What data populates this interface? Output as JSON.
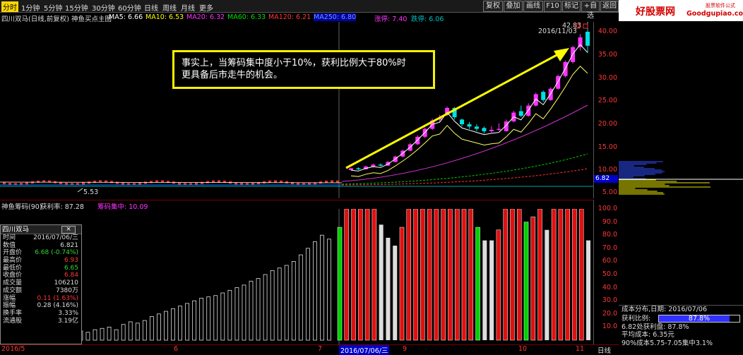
{
  "toolbar": {
    "timeframes": [
      "分时",
      "1分钟",
      "5分钟",
      "15分钟",
      "30分钟",
      "60分钟",
      "日线",
      "周线",
      "月线",
      "更多"
    ],
    "active": "分时",
    "right_buttons": [
      "复权",
      "叠加",
      "画线",
      "F10",
      "标记",
      "+自选",
      "返回"
    ]
  },
  "brand": {
    "logo": "好股票网",
    "small": "股票软件公式",
    "url": "Goodgupiao.com"
  },
  "infobar": {
    "title": "四川双马(日线,前复权) 神鱼买点主图",
    "ma5": "MA5: 6.66",
    "ma10": "MA10: 6.53",
    "ma20": "MA20: 6.32",
    "ma60": "MA60: 6.33",
    "ma120": "MA120: 6.21",
    "ma250": "MA250: 6.80",
    "zt": "涨停: 7.40",
    "dt": "跌停: 6.06"
  },
  "main_chart": {
    "high_label": "2016/11/03",
    "high_value": "42.83",
    "low_value": "5.53",
    "current_price": "6.82",
    "y_ticks": [
      "40.00",
      "35.00",
      "30.00",
      "25.00",
      "20.00",
      "15.00",
      "10.00",
      "5.00"
    ],
    "y_values": [
      40,
      35,
      30,
      25,
      20,
      15,
      10,
      5
    ],
    "candles": [
      {
        "o": 10.0,
        "c": 10.4,
        "h": 10.5,
        "l": 9.9
      },
      {
        "o": 10.4,
        "c": 10.2,
        "h": 10.6,
        "l": 10.0
      },
      {
        "o": 10.2,
        "c": 10.8,
        "h": 11.0,
        "l": 10.1
      },
      {
        "o": 10.8,
        "c": 11.2,
        "h": 11.4,
        "l": 10.6
      },
      {
        "o": 11.2,
        "c": 11.0,
        "h": 11.5,
        "l": 10.8
      },
      {
        "o": 11.0,
        "c": 11.8,
        "h": 12.0,
        "l": 10.9
      },
      {
        "o": 11.8,
        "c": 13.0,
        "h": 13.2,
        "l": 11.7
      },
      {
        "o": 13.0,
        "c": 14.3,
        "h": 14.5,
        "l": 12.8
      },
      {
        "o": 14.3,
        "c": 15.7,
        "h": 16.0,
        "l": 14.2
      },
      {
        "o": 15.7,
        "c": 17.3,
        "h": 17.6,
        "l": 15.5
      },
      {
        "o": 17.3,
        "c": 19.0,
        "h": 19.3,
        "l": 17.0
      },
      {
        "o": 19.0,
        "c": 20.8,
        "h": 21.2,
        "l": 18.8
      },
      {
        "o": 21.0,
        "c": 21.3,
        "h": 22.0,
        "l": 20.5
      },
      {
        "o": 22.0,
        "c": 23.5,
        "h": 23.8,
        "l": 21.8
      },
      {
        "o": 23.5,
        "c": 21.5,
        "h": 23.7,
        "l": 21.0
      },
      {
        "o": 21.0,
        "c": 20.0,
        "h": 21.2,
        "l": 19.5
      },
      {
        "o": 20.0,
        "c": 19.5,
        "h": 20.5,
        "l": 19.0
      },
      {
        "o": 19.5,
        "c": 19.0,
        "h": 20.0,
        "l": 18.5
      },
      {
        "o": 19.2,
        "c": 18.5,
        "h": 19.5,
        "l": 18.0
      },
      {
        "o": 18.5,
        "c": 18.8,
        "h": 19.6,
        "l": 18.2
      },
      {
        "o": 18.8,
        "c": 19.0,
        "h": 20.2,
        "l": 18.6
      },
      {
        "o": 18.5,
        "c": 20.6,
        "h": 21.0,
        "l": 18.4
      },
      {
        "o": 20.6,
        "c": 22.5,
        "h": 22.9,
        "l": 20.4
      },
      {
        "o": 22.8,
        "c": 21.8,
        "h": 24.0,
        "l": 21.5
      },
      {
        "o": 21.8,
        "c": 24.0,
        "h": 24.5,
        "l": 21.6
      },
      {
        "o": 24.0,
        "c": 26.5,
        "h": 26.8,
        "l": 23.8
      },
      {
        "o": 27.0,
        "c": 25.2,
        "h": 27.3,
        "l": 24.8
      },
      {
        "o": 25.2,
        "c": 27.7,
        "h": 28.0,
        "l": 25.0
      },
      {
        "o": 27.7,
        "c": 30.5,
        "h": 30.8,
        "l": 27.5
      },
      {
        "o": 30.5,
        "c": 33.5,
        "h": 33.8,
        "l": 30.2
      },
      {
        "o": 33.5,
        "c": 36.7,
        "h": 37.0,
        "l": 33.2
      },
      {
        "o": 36.7,
        "c": 38.8,
        "h": 39.5,
        "l": 36.0
      },
      {
        "o": 40.0,
        "c": 37.0,
        "h": 42.8,
        "l": 35.5
      }
    ]
  },
  "callout": {
    "line1": "事实上，当筹码集中度小于10%，获利比例大于80%时",
    "line2": "更具备后市走牛的机会。"
  },
  "indicator": {
    "title": "神鱼筹码(90)",
    "profit_label": "获利率: 87.28",
    "conc_label": "筹码集中: 10.09",
    "y_ticks": [
      "100.0",
      "90.0",
      "80.0",
      "70.0",
      "60.0",
      "50.0",
      "40.0",
      "30.0",
      "20.0",
      "10.0"
    ],
    "y_values": [
      100,
      90,
      80,
      70,
      60,
      50,
      40,
      30,
      20,
      10
    ],
    "pre_bars": [
      3,
      2,
      4,
      3,
      5,
      3,
      4,
      6,
      5,
      7,
      6,
      8,
      9,
      10,
      8,
      12,
      14,
      13,
      15,
      18,
      20,
      22,
      24,
      26,
      28,
      30,
      32,
      33,
      34,
      36,
      38,
      40,
      42,
      45,
      47,
      50,
      53,
      55,
      57,
      60,
      65,
      70,
      75,
      80,
      77
    ],
    "post_bars": [
      {
        "v": 86,
        "c": "g"
      },
      {
        "v": 100,
        "c": "r"
      },
      {
        "v": 100,
        "c": "r"
      },
      {
        "v": 100,
        "c": "r"
      },
      {
        "v": 100,
        "c": "r"
      },
      {
        "v": 100,
        "c": "r"
      },
      {
        "v": 88,
        "c": "w"
      },
      {
        "v": 78,
        "c": "w"
      },
      {
        "v": 72,
        "c": "w"
      },
      {
        "v": 86,
        "c": "r"
      },
      {
        "v": 100,
        "c": "r"
      },
      {
        "v": 100,
        "c": "r"
      },
      {
        "v": 100,
        "c": "r"
      },
      {
        "v": 100,
        "c": "r"
      },
      {
        "v": 100,
        "c": "r"
      },
      {
        "v": 100,
        "c": "r"
      },
      {
        "v": 100,
        "c": "r"
      },
      {
        "v": 100,
        "c": "r"
      },
      {
        "v": 100,
        "c": "r"
      },
      {
        "v": 100,
        "c": "r"
      },
      {
        "v": 86,
        "c": "g"
      },
      {
        "v": 76,
        "c": "w"
      },
      {
        "v": 76,
        "c": "w"
      },
      {
        "v": 84,
        "c": "r"
      },
      {
        "v": 100,
        "c": "r"
      },
      {
        "v": 100,
        "c": "r"
      },
      {
        "v": 100,
        "c": "r"
      },
      {
        "v": 90,
        "c": "g"
      },
      {
        "v": 94,
        "c": "r"
      },
      {
        "v": 100,
        "c": "r"
      },
      {
        "v": 84,
        "c": "w"
      },
      {
        "v": 100,
        "c": "r"
      },
      {
        "v": 100,
        "c": "r"
      },
      {
        "v": 100,
        "c": "r"
      },
      {
        "v": 100,
        "c": "r"
      },
      {
        "v": 100,
        "c": "r"
      },
      {
        "v": 76,
        "c": "w"
      }
    ]
  },
  "dates": {
    "d0": "2016/5",
    "d1": "6",
    "d2": "7",
    "cursor": "2016/07/06/三",
    "d3": "9",
    "d4": "10",
    "d5": "11",
    "weekly": "日线"
  },
  "quote": {
    "title": "四川双马",
    "close": "×",
    "rows": [
      {
        "label": "时间",
        "value": "2016/07/06/三",
        "color": "#ddd"
      },
      {
        "label": "数值",
        "value": "6.821",
        "color": "#ddd"
      },
      {
        "label": "开盘价",
        "value": "6.68 (-0.74%)",
        "color": "#34d834"
      },
      {
        "label": "最高价",
        "value": "6.93",
        "color": "#ff3838"
      },
      {
        "label": "最低价",
        "value": "6.65",
        "color": "#34d834"
      },
      {
        "label": "收盘价",
        "value": "6.84",
        "color": "#ff3838"
      },
      {
        "label": "成交量",
        "value": "106210",
        "color": "#ddd"
      },
      {
        "label": "成交额",
        "value": "7380万",
        "color": "#ddd"
      },
      {
        "label": "涨幅",
        "value": "0.11 (1.63%)",
        "color": "#ff3838"
      },
      {
        "label": "振幅",
        "value": "0.28 (4.16%)",
        "color": "#ddd"
      },
      {
        "label": "换手率",
        "value": "3.33%",
        "color": "#ddd"
      },
      {
        "label": "流通股",
        "value": "3.19亿",
        "color": "#ddd"
      }
    ]
  },
  "cost": {
    "title": "成本分布,日期: 2016/07/06",
    "profit_label": "获利比例:",
    "profit_value": "87.8%",
    "profit_fraction": 0.878,
    "line2": "6.82处获利盘: 87.8%",
    "line3": "平均成本: 6.35元",
    "line4": "90%成本5.75-7.05集中3.1%"
  },
  "colors": {
    "up": "#ff3030",
    "down": "#00e0e0",
    "magenta": "#ff33ff",
    "accent": "#ffff00"
  }
}
